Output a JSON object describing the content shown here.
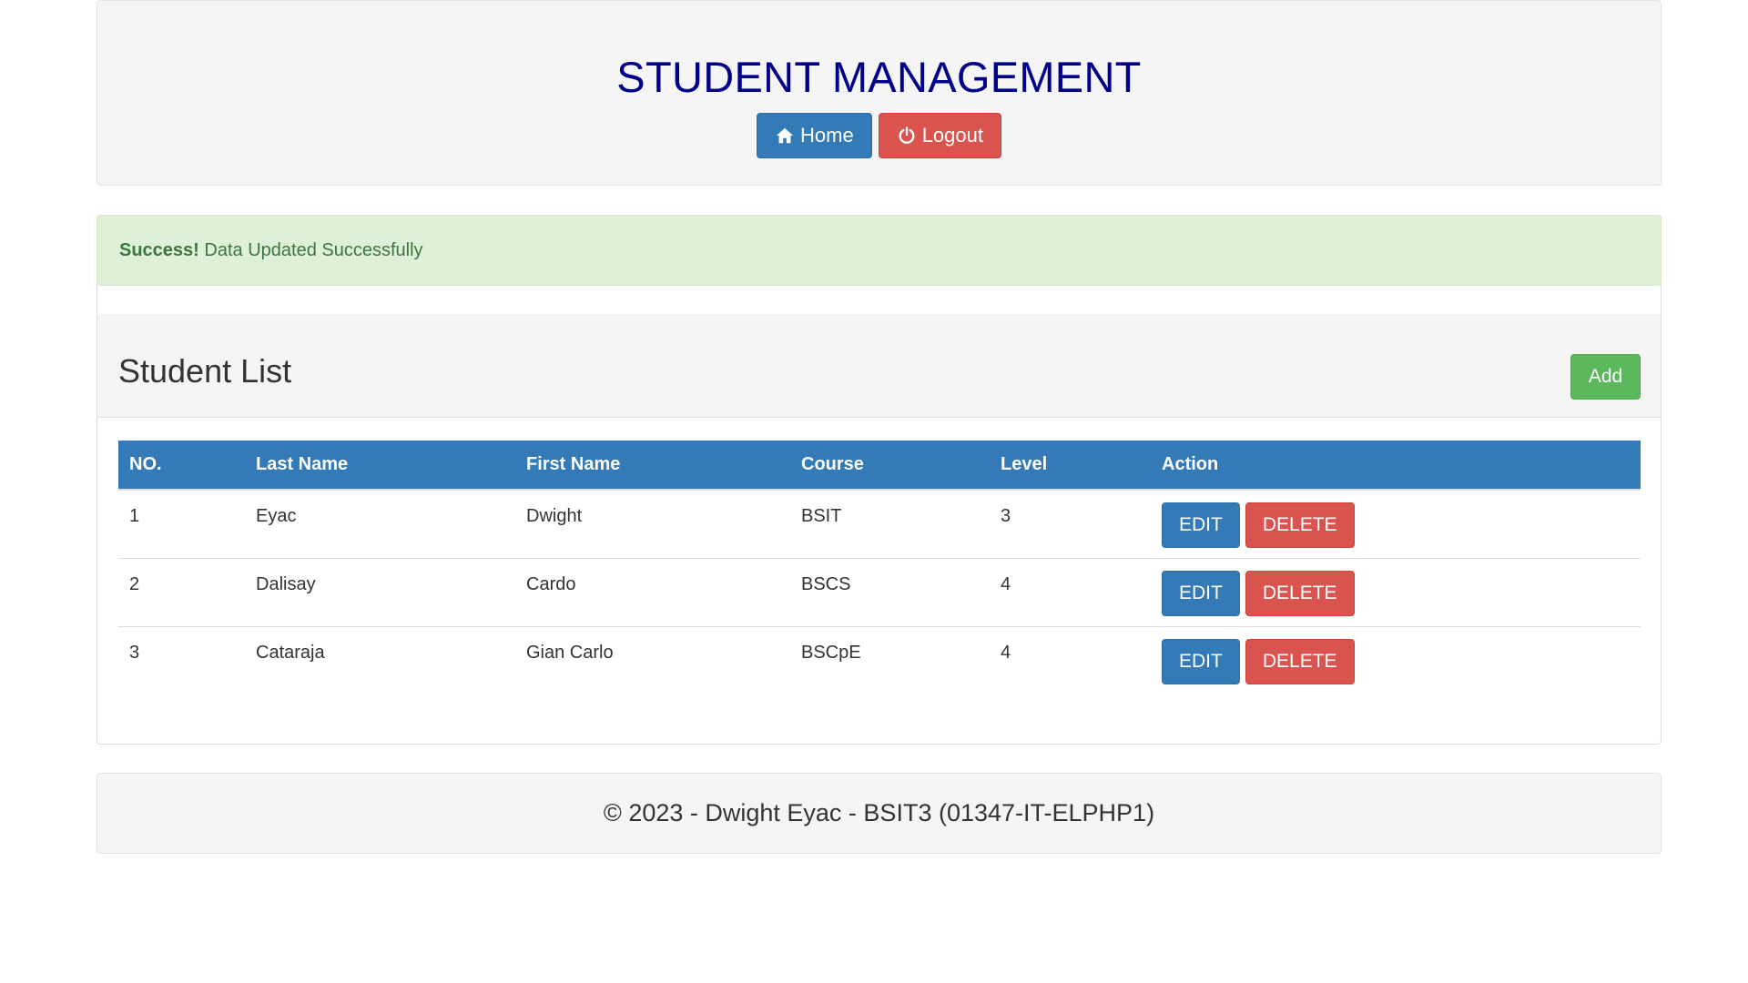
{
  "header": {
    "title": "STUDENT MANAGEMENT",
    "home_label": "Home",
    "logout_label": "Logout"
  },
  "alert": {
    "strong": "Success!",
    "message": "Data Updated Successfully"
  },
  "panel": {
    "title": "Student List",
    "add_label": "Add"
  },
  "table": {
    "headers": [
      "NO.",
      "Last Name",
      "First Name",
      "Course",
      "Level",
      "Action"
    ],
    "rows": [
      {
        "no": "1",
        "last": "Eyac",
        "first": "Dwight",
        "course": "BSIT",
        "level": "3"
      },
      {
        "no": "2",
        "last": "Dalisay",
        "first": "Cardo",
        "course": "BSCS",
        "level": "4"
      },
      {
        "no": "3",
        "last": "Cataraja",
        "first": "Gian Carlo",
        "course": "BSCpE",
        "level": "4"
      }
    ],
    "edit_label": "EDIT",
    "delete_label": "DELETE"
  },
  "footer": {
    "text": "© 2023 - Dwight Eyac - BSIT3 (01347-IT-ELPHP1)"
  },
  "colors": {
    "title": "#00008b",
    "primary": "#337ab7",
    "danger": "#d9534f",
    "success": "#5cb85c",
    "alert_bg": "#dff0d8",
    "alert_text": "#3c763d"
  },
  "icons": {
    "home": "home-icon",
    "logout": "power-icon"
  }
}
